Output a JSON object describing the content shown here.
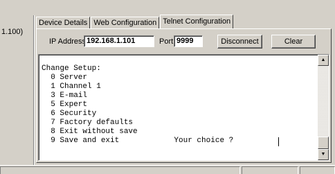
{
  "left_pane": {
    "text": "1.100)"
  },
  "tabs": [
    {
      "label": "Device Details",
      "active": false
    },
    {
      "label": "Web Configuration",
      "active": false
    },
    {
      "label": "Telnet Configuration",
      "active": true
    }
  ],
  "toolbar": {
    "ip_label": "IP Address",
    "ip_value": "192.168.1.101",
    "port_label": "Port",
    "port_value": "9999",
    "disconnect_label": "Disconnect",
    "clear_label": "Clear"
  },
  "console": {
    "lines": [
      "Change Setup:",
      "  0 Server",
      "  1 Channel 1",
      "  3 E-mail",
      "  5 Expert",
      "  6 Security",
      "  7 Factory defaults",
      "  8 Exit without save",
      "  9 Save and exit            Your choice ? "
    ]
  },
  "scrollbar": {
    "up_icon": "▲",
    "down_icon": "▼"
  }
}
